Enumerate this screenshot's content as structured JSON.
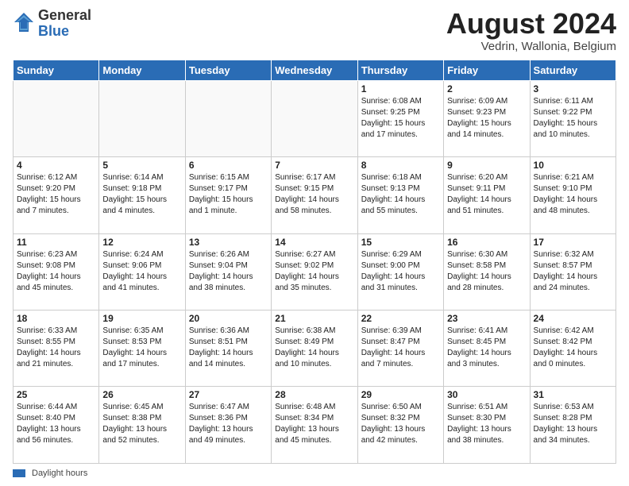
{
  "logo": {
    "general": "General",
    "blue": "Blue"
  },
  "title": "August 2024",
  "location": "Vedrin, Wallonia, Belgium",
  "days_of_week": [
    "Sunday",
    "Monday",
    "Tuesday",
    "Wednesday",
    "Thursday",
    "Friday",
    "Saturday"
  ],
  "footer_legend": "Daylight hours",
  "weeks": [
    [
      {
        "day": "",
        "info": ""
      },
      {
        "day": "",
        "info": ""
      },
      {
        "day": "",
        "info": ""
      },
      {
        "day": "",
        "info": ""
      },
      {
        "day": "1",
        "info": "Sunrise: 6:08 AM\nSunset: 9:25 PM\nDaylight: 15 hours and 17 minutes."
      },
      {
        "day": "2",
        "info": "Sunrise: 6:09 AM\nSunset: 9:23 PM\nDaylight: 15 hours and 14 minutes."
      },
      {
        "day": "3",
        "info": "Sunrise: 6:11 AM\nSunset: 9:22 PM\nDaylight: 15 hours and 10 minutes."
      }
    ],
    [
      {
        "day": "4",
        "info": "Sunrise: 6:12 AM\nSunset: 9:20 PM\nDaylight: 15 hours and 7 minutes."
      },
      {
        "day": "5",
        "info": "Sunrise: 6:14 AM\nSunset: 9:18 PM\nDaylight: 15 hours and 4 minutes."
      },
      {
        "day": "6",
        "info": "Sunrise: 6:15 AM\nSunset: 9:17 PM\nDaylight: 15 hours and 1 minute."
      },
      {
        "day": "7",
        "info": "Sunrise: 6:17 AM\nSunset: 9:15 PM\nDaylight: 14 hours and 58 minutes."
      },
      {
        "day": "8",
        "info": "Sunrise: 6:18 AM\nSunset: 9:13 PM\nDaylight: 14 hours and 55 minutes."
      },
      {
        "day": "9",
        "info": "Sunrise: 6:20 AM\nSunset: 9:11 PM\nDaylight: 14 hours and 51 minutes."
      },
      {
        "day": "10",
        "info": "Sunrise: 6:21 AM\nSunset: 9:10 PM\nDaylight: 14 hours and 48 minutes."
      }
    ],
    [
      {
        "day": "11",
        "info": "Sunrise: 6:23 AM\nSunset: 9:08 PM\nDaylight: 14 hours and 45 minutes."
      },
      {
        "day": "12",
        "info": "Sunrise: 6:24 AM\nSunset: 9:06 PM\nDaylight: 14 hours and 41 minutes."
      },
      {
        "day": "13",
        "info": "Sunrise: 6:26 AM\nSunset: 9:04 PM\nDaylight: 14 hours and 38 minutes."
      },
      {
        "day": "14",
        "info": "Sunrise: 6:27 AM\nSunset: 9:02 PM\nDaylight: 14 hours and 35 minutes."
      },
      {
        "day": "15",
        "info": "Sunrise: 6:29 AM\nSunset: 9:00 PM\nDaylight: 14 hours and 31 minutes."
      },
      {
        "day": "16",
        "info": "Sunrise: 6:30 AM\nSunset: 8:58 PM\nDaylight: 14 hours and 28 minutes."
      },
      {
        "day": "17",
        "info": "Sunrise: 6:32 AM\nSunset: 8:57 PM\nDaylight: 14 hours and 24 minutes."
      }
    ],
    [
      {
        "day": "18",
        "info": "Sunrise: 6:33 AM\nSunset: 8:55 PM\nDaylight: 14 hours and 21 minutes."
      },
      {
        "day": "19",
        "info": "Sunrise: 6:35 AM\nSunset: 8:53 PM\nDaylight: 14 hours and 17 minutes."
      },
      {
        "day": "20",
        "info": "Sunrise: 6:36 AM\nSunset: 8:51 PM\nDaylight: 14 hours and 14 minutes."
      },
      {
        "day": "21",
        "info": "Sunrise: 6:38 AM\nSunset: 8:49 PM\nDaylight: 14 hours and 10 minutes."
      },
      {
        "day": "22",
        "info": "Sunrise: 6:39 AM\nSunset: 8:47 PM\nDaylight: 14 hours and 7 minutes."
      },
      {
        "day": "23",
        "info": "Sunrise: 6:41 AM\nSunset: 8:45 PM\nDaylight: 14 hours and 3 minutes."
      },
      {
        "day": "24",
        "info": "Sunrise: 6:42 AM\nSunset: 8:42 PM\nDaylight: 14 hours and 0 minutes."
      }
    ],
    [
      {
        "day": "25",
        "info": "Sunrise: 6:44 AM\nSunset: 8:40 PM\nDaylight: 13 hours and 56 minutes."
      },
      {
        "day": "26",
        "info": "Sunrise: 6:45 AM\nSunset: 8:38 PM\nDaylight: 13 hours and 52 minutes."
      },
      {
        "day": "27",
        "info": "Sunrise: 6:47 AM\nSunset: 8:36 PM\nDaylight: 13 hours and 49 minutes."
      },
      {
        "day": "28",
        "info": "Sunrise: 6:48 AM\nSunset: 8:34 PM\nDaylight: 13 hours and 45 minutes."
      },
      {
        "day": "29",
        "info": "Sunrise: 6:50 AM\nSunset: 8:32 PM\nDaylight: 13 hours and 42 minutes."
      },
      {
        "day": "30",
        "info": "Sunrise: 6:51 AM\nSunset: 8:30 PM\nDaylight: 13 hours and 38 minutes."
      },
      {
        "day": "31",
        "info": "Sunrise: 6:53 AM\nSunset: 8:28 PM\nDaylight: 13 hours and 34 minutes."
      }
    ]
  ]
}
